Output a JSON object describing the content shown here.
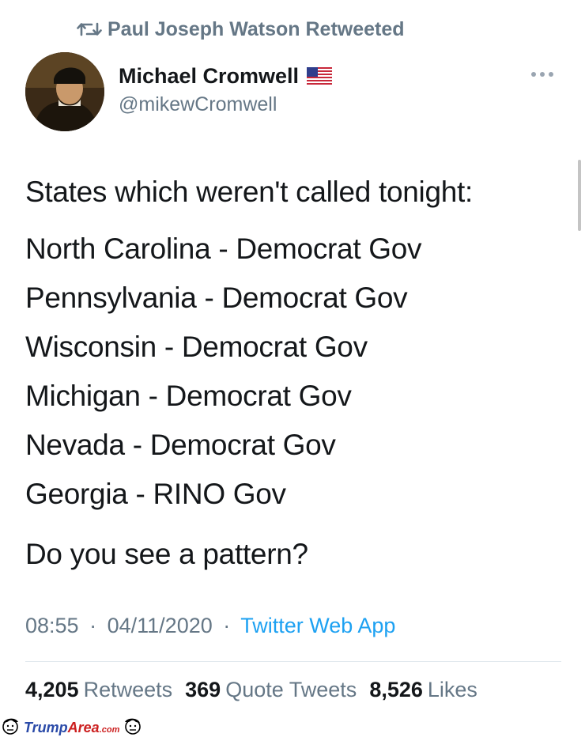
{
  "retweet": {
    "text": "Paul Joseph Watson Retweeted"
  },
  "author": {
    "name": "Michael Cromwell",
    "handle": "@mikewCromwell",
    "flag_icon": "us-flag-icon"
  },
  "tweet": {
    "intro": "States which weren't called tonight:",
    "lines": [
      "North Carolina - Democrat Gov",
      "Pennsylvania - Democrat Gov",
      "Wisconsin - Democrat Gov",
      "Michigan - Democrat Gov",
      "Nevada - Democrat Gov",
      "Georgia - RINO Gov"
    ],
    "outro": "Do you see a pattern?"
  },
  "meta": {
    "time": "08:55",
    "separator": "·",
    "date": "04/11/2020",
    "source": "Twitter Web App"
  },
  "stats": {
    "retweets_count": "4,205",
    "retweets_label": "Retweets",
    "quotes_count": "369",
    "quotes_label": "Quote Tweets",
    "likes_count": "8,526",
    "likes_label": "Likes"
  },
  "watermark": {
    "brand_part1": "Trump",
    "brand_part2": "Area",
    "brand_suffix": ".com"
  },
  "colors": {
    "text_primary": "#14171a",
    "text_secondary": "#657786",
    "link": "#1da1f2",
    "divider": "#e1e8ed"
  }
}
